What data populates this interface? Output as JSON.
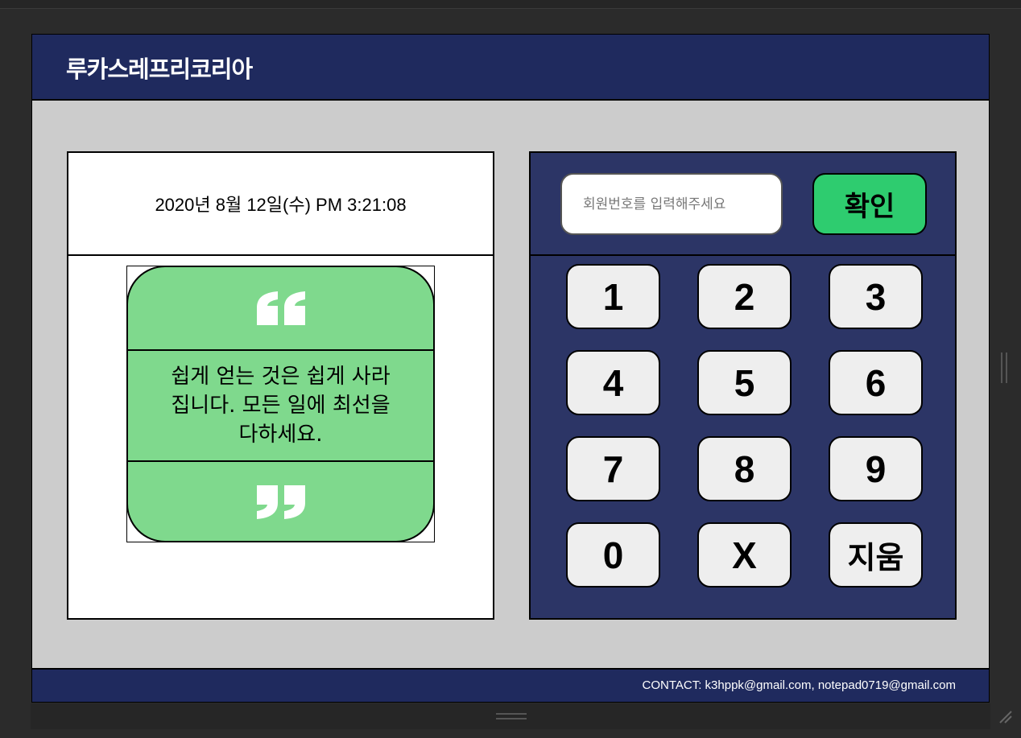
{
  "header": {
    "brand": "루카스레프리코리아"
  },
  "datetime": "2020년 8월 12일(수) PM 3:21:08",
  "quote": {
    "text": "쉽게 얻는 것은 쉽게 사라 집니다. 모든 일에 최선을 다하세요.",
    "open_icon": "open-quote-icon",
    "close_icon": "close-quote-icon",
    "card_color": "#7fd98d"
  },
  "member": {
    "placeholder": "회원번호를 입력해주세요",
    "value": "",
    "confirm_label": "확인"
  },
  "keypad": {
    "k1": "1",
    "k2": "2",
    "k3": "3",
    "k4": "4",
    "k5": "5",
    "k6": "6",
    "k7": "7",
    "k8": "8",
    "k9": "9",
    "k0": "0",
    "kx": "X",
    "kdel": "지움"
  },
  "footer": {
    "contact": "CONTACT: k3hppk@gmail.com, notepad0719@gmail.com"
  },
  "colors": {
    "header_bg": "#1f2a5e",
    "panel_bg": "#2c3566",
    "confirm_bg": "#2ecc6f",
    "key_bg": "#eeeeee",
    "page_bg": "#cccccc"
  }
}
